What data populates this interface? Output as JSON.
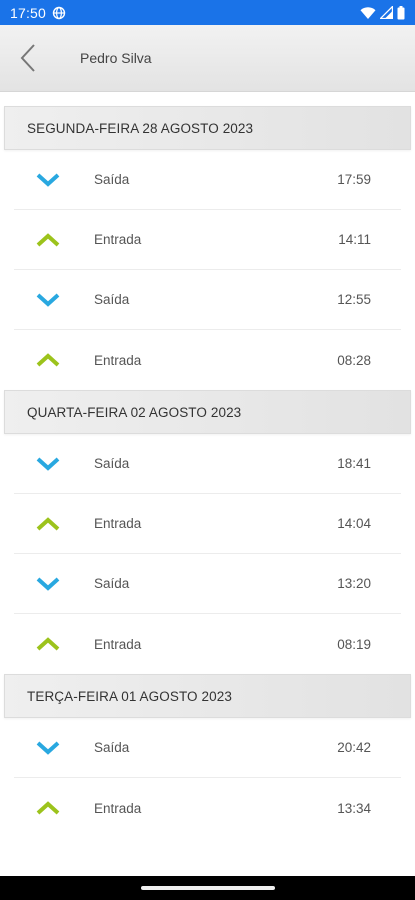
{
  "status_bar": {
    "time": "17:50",
    "icons": [
      "globe-icon",
      "wifi-icon",
      "signal-icon",
      "battery-icon"
    ],
    "color": "#1a73e8"
  },
  "header": {
    "back_icon": "chevron-left-icon",
    "title": "Pedro Silva"
  },
  "colors": {
    "saida": "#29a8e0",
    "entrada": "#9cc31c"
  },
  "days": [
    {
      "title": "SEGUNDA-FEIRA 28 AGOSTO 2023",
      "entries": [
        {
          "type": "saida",
          "label": "Saída",
          "time": "17:59"
        },
        {
          "type": "entrada",
          "label": "Entrada",
          "time": "14:11"
        },
        {
          "type": "saida",
          "label": "Saída",
          "time": "12:55"
        },
        {
          "type": "entrada",
          "label": "Entrada",
          "time": "08:28"
        }
      ]
    },
    {
      "title": "QUARTA-FEIRA 02 AGOSTO 2023",
      "entries": [
        {
          "type": "saida",
          "label": "Saída",
          "time": "18:41"
        },
        {
          "type": "entrada",
          "label": "Entrada",
          "time": "14:04"
        },
        {
          "type": "saida",
          "label": "Saída",
          "time": "13:20"
        },
        {
          "type": "entrada",
          "label": "Entrada",
          "time": "08:19"
        }
      ]
    },
    {
      "title": "TERÇA-FEIRA 01 AGOSTO 2023",
      "entries": [
        {
          "type": "saida",
          "label": "Saída",
          "time": "20:42"
        },
        {
          "type": "entrada",
          "label": "Entrada",
          "time": "13:34"
        }
      ]
    }
  ]
}
